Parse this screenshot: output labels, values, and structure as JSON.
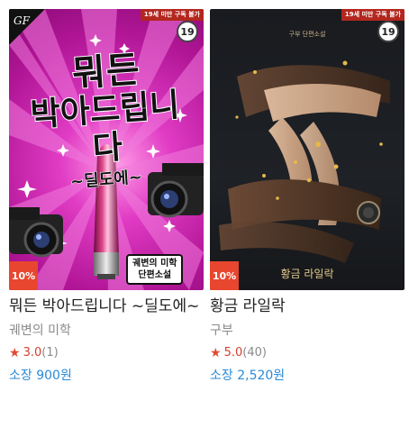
{
  "books": [
    {
      "title": "뭐든 박아드립니다 ~딜도에~",
      "author": "궤변의 미학",
      "rating": "3.0",
      "rating_count": "(1)",
      "price_label": "소장",
      "price": "900원",
      "discount": "10%",
      "age_notice": "19세 미만 구독 불가",
      "age_badge": "19",
      "cover_title_line1": "뭐든",
      "cover_title_line2": "박아드립니다",
      "cover_title_line3": "~딜도에~",
      "cover_badge_line1": "궤변의 미학",
      "cover_badge_line2": "단편소설",
      "cover_logo": "GF"
    },
    {
      "title": "황금 라일락",
      "author": "구부",
      "rating": "5.0",
      "rating_count": "(40)",
      "price_label": "소장",
      "price": "2,520원",
      "discount": "10%",
      "age_notice": "19세 미만 구독 불가",
      "age_badge": "19",
      "cover_series": "구부 단편소설",
      "cover_title": "황금 라일락"
    }
  ],
  "colors": {
    "accent_blue": "#2a8ad6",
    "rating_red": "#d2402f",
    "discount_red": "#e8462f"
  },
  "icons": {
    "rating": "star-icon"
  }
}
